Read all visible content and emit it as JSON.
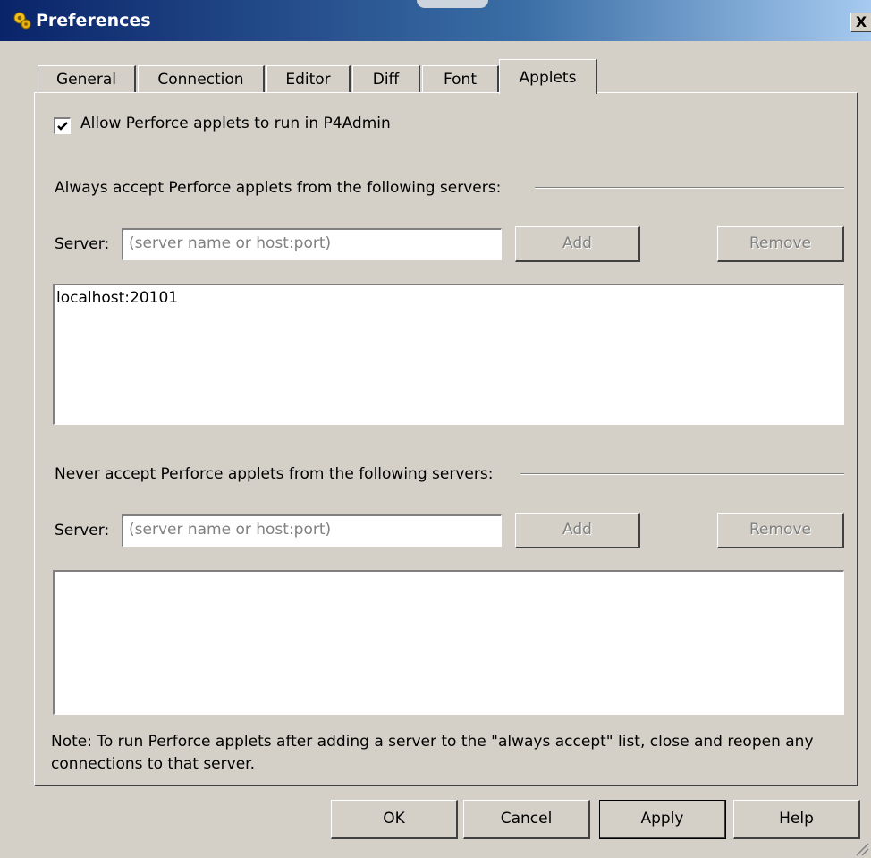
{
  "window": {
    "title": "Preferences",
    "close_label": "X"
  },
  "tabs": [
    {
      "label": "General",
      "active": false
    },
    {
      "label": "Connection",
      "active": false
    },
    {
      "label": "Editor",
      "active": false
    },
    {
      "label": "Diff",
      "active": false
    },
    {
      "label": "Font",
      "active": false
    },
    {
      "label": "Applets",
      "active": true
    }
  ],
  "applets": {
    "allow_checkbox": {
      "label": "Allow Perforce applets to run in P4Admin",
      "checked": true
    },
    "always": {
      "heading": "Always accept Perforce applets from the following servers:",
      "server_label": "Server:",
      "server_placeholder": "(server name or host:port)",
      "add_label": "Add",
      "remove_label": "Remove",
      "items": [
        "localhost:20101"
      ]
    },
    "never": {
      "heading": "Never accept Perforce applets from the following servers:",
      "server_label": "Server:",
      "server_placeholder": "(server name or host:port)",
      "add_label": "Add",
      "remove_label": "Remove",
      "items": []
    },
    "note": "Note: To run Perforce applets after adding a server to the \"always accept\" list, close and reopen any connections to that server."
  },
  "footer": {
    "ok_label": "OK",
    "cancel_label": "Cancel",
    "apply_label": "Apply",
    "help_label": "Help"
  },
  "icons": {
    "app": "perforce-gears-icon",
    "close": "close-icon",
    "checkmark": "checkmark-icon",
    "resize": "resize-grip-icon"
  },
  "colors": {
    "title_gradient_start": "#0a246a",
    "title_gradient_end": "#a6caf0",
    "face": "#d4d0c8",
    "disabled_text": "#808080"
  }
}
